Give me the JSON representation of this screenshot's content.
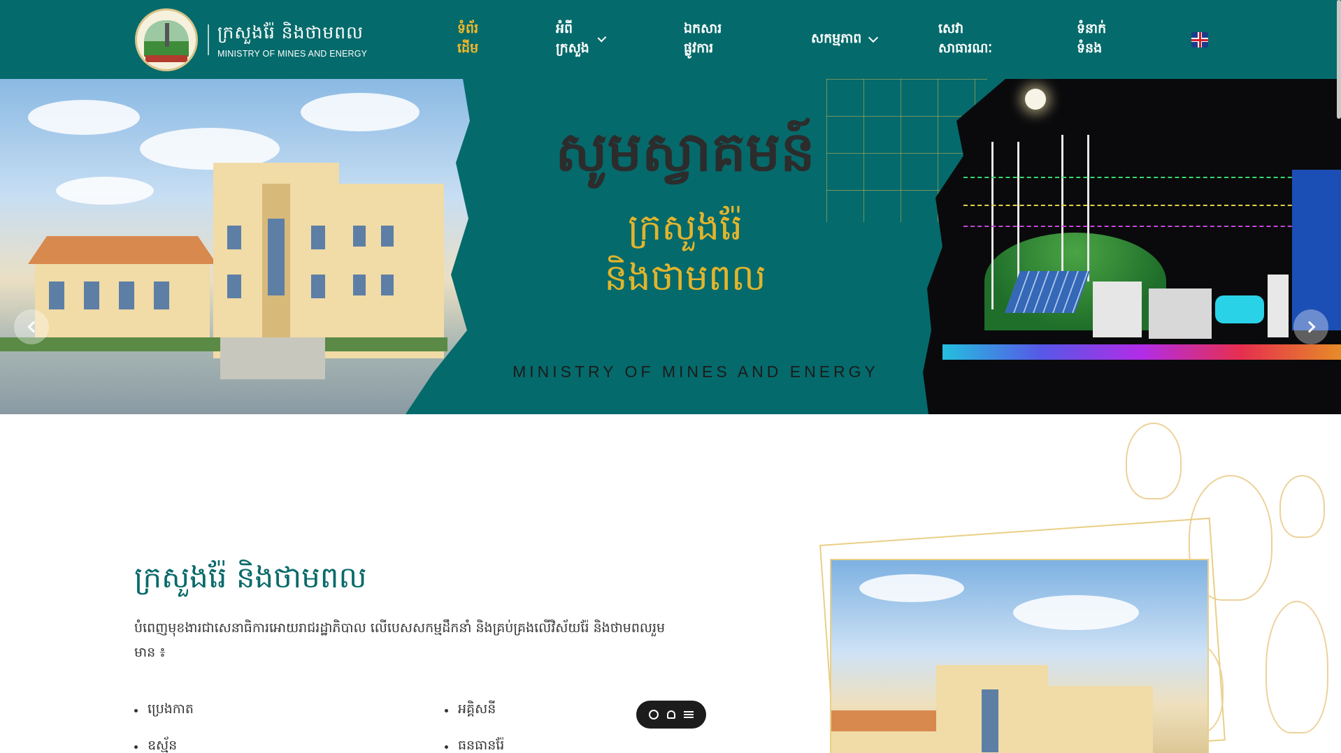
{
  "header": {
    "logo_km": "ក្រសួងរ៉ែ និងថាមពល",
    "logo_en": "MINISTRY OF MINES AND ENERGY",
    "nav": [
      {
        "label": "ទំព័រដើម",
        "active": true,
        "dropdown": false
      },
      {
        "label": "អំពីក្រសួង",
        "active": false,
        "dropdown": true
      },
      {
        "label": "ឯកសារផ្លូវការ",
        "active": false,
        "dropdown": false
      },
      {
        "label": "សកម្មភាព",
        "active": false,
        "dropdown": true
      },
      {
        "label": "សេវាសាធារណៈ",
        "active": false,
        "dropdown": false
      },
      {
        "label": "ទំនាក់ទំនង",
        "active": false,
        "dropdown": false
      }
    ],
    "language_icon": "uk-flag-icon"
  },
  "hero": {
    "title": "សូមស្វាគមន៍",
    "subtitle_line1": "ក្រសួងរ៉ែ",
    "subtitle_line2": "និងថាមពល",
    "english": "MINISTRY OF MINES AND ENERGY"
  },
  "about": {
    "title": "ក្រសួងរ៉ែ និងថាមពល",
    "description": "បំពេញមុខងារជាសេនាធិការអោយរាជរដ្ឋាភិបាល លើបេសសកម្មដឹកនាំ និងគ្រប់គ្រងលើវិស័យរ៉ែ និងថាមពលរួមមាន ៖",
    "items": [
      "ប្រេងកាត",
      "អគ្គិសនី",
      "ឧស្ម័ន",
      "ធនធានរ៉ែ"
    ]
  },
  "colors": {
    "primary": "#056a6b",
    "accent": "#f2b92b",
    "gold_text": "#e2b42c"
  }
}
